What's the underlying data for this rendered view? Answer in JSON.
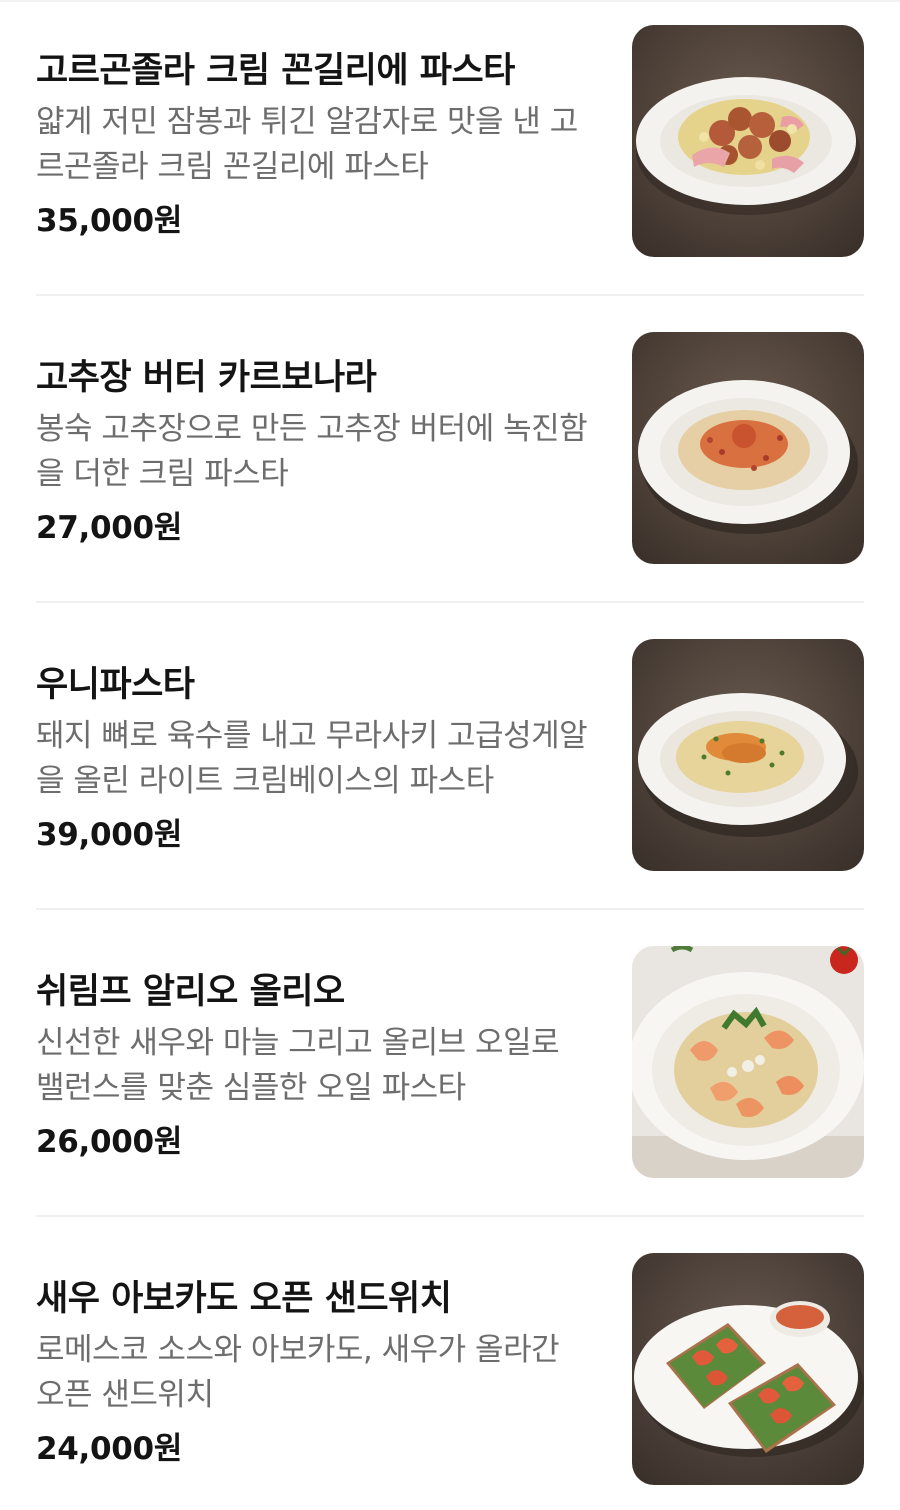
{
  "menu": {
    "items": [
      {
        "name": "고르곤졸라 크림 꼰길리에 파스타",
        "description": "얇게 저민 잠봉과 튀긴 알감자로 맛을 낸 고르곤졸라 크림 꼰길리에 파스타",
        "price": "35,000원",
        "image_icon": "pasta-conchiglie-photo"
      },
      {
        "name": "고추장 버터 카르보나라",
        "description": "봉숙 고추장으로 만든 고추장 버터에 녹진함을 더한 크림 파스타",
        "price": "27,000원",
        "image_icon": "carbonara-photo"
      },
      {
        "name": "우니파스타",
        "description": "돼지 뼈로 육수를 내고 무라사키 고급성게알을 올린 라이트 크림베이스의 파스타",
        "price": "39,000원",
        "image_icon": "uni-pasta-photo"
      },
      {
        "name": "쉬림프 알리오 올리오",
        "description": "신선한 새우와 마늘 그리고 올리브 오일로 밸런스를 맞춘 심플한 오일 파스타",
        "price": "26,000원",
        "image_icon": "shrimp-aglio-olio-photo"
      },
      {
        "name": "새우 아보카도 오픈 샌드위치",
        "description": "로메스코 소스와 아보카도, 새우가 올라간 오픈 샌드위치",
        "price": "24,000원",
        "image_icon": "shrimp-avocado-sandwich-photo"
      }
    ]
  },
  "colors": {
    "title": "#141414",
    "description": "#6d6d6d",
    "divider": "#f0f0f0",
    "photo_background_dark": "#4a3f37"
  }
}
